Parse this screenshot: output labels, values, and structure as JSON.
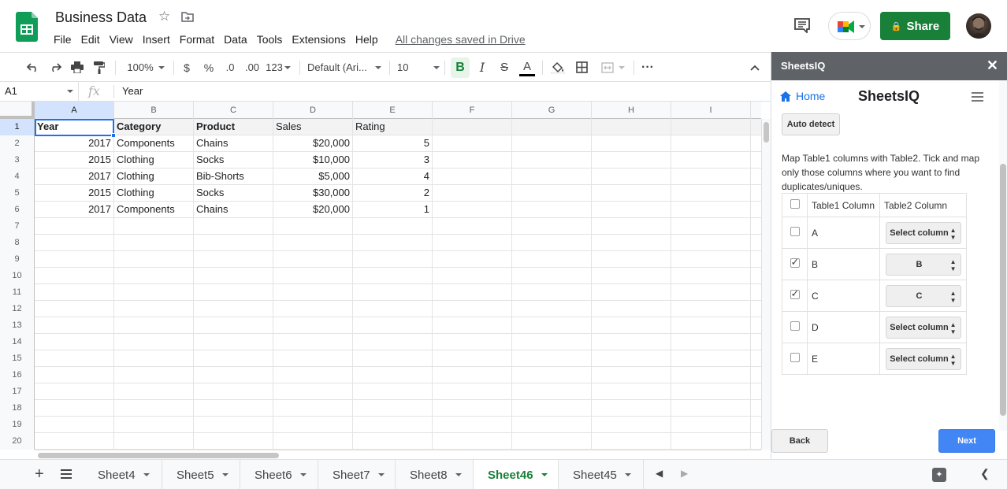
{
  "header": {
    "title": "Business Data",
    "menu": [
      "File",
      "Edit",
      "View",
      "Insert",
      "Format",
      "Data",
      "Tools",
      "Extensions",
      "Help"
    ],
    "saved_status": "All changes saved in Drive",
    "share_label": "Share"
  },
  "toolbar": {
    "zoom": "100%",
    "currency": "$",
    "percent": "%",
    "decrease_decimal": ".0",
    "increase_decimal": ".00",
    "more_formats": "123",
    "font": "Default (Ari...",
    "font_size": "10",
    "bold": "B",
    "text_color": "A",
    "more": "···"
  },
  "formula_bar": {
    "cell_ref": "A1",
    "fx": "fx",
    "value": "Year"
  },
  "grid": {
    "columns": [
      "A",
      "B",
      "C",
      "D",
      "E",
      "F",
      "G",
      "H",
      "I"
    ],
    "row_numbers": [
      "1",
      "2",
      "3",
      "4",
      "5",
      "6",
      "7",
      "8",
      "9",
      "10",
      "11",
      "12",
      "13",
      "14",
      "15",
      "16",
      "17",
      "18",
      "19",
      "20"
    ],
    "header_row": [
      "Year",
      "Category",
      "Product",
      "Sales",
      "Rating"
    ],
    "rows": [
      [
        "2017",
        "Components",
        "Chains",
        "$20,000",
        "5"
      ],
      [
        "2015",
        "Clothing",
        "Socks",
        "$10,000",
        "3"
      ],
      [
        "2017",
        "Clothing",
        "Bib-Shorts",
        "$5,000",
        "4"
      ],
      [
        "2015",
        "Clothing",
        "Socks",
        "$30,000",
        "2"
      ],
      [
        "2017",
        "Components",
        "Chains",
        "$20,000",
        "1"
      ]
    ]
  },
  "sheets": {
    "tabs": [
      "Sheet4",
      "Sheet5",
      "Sheet6",
      "Sheet7",
      "Sheet8",
      "Sheet46",
      "Sheet45"
    ],
    "active": "Sheet46"
  },
  "panel": {
    "title": "SheetsIQ",
    "close": "✕",
    "home": "Home",
    "brand": "SheetsIQ",
    "auto_detect": "Auto detect",
    "instructions": "Map Table1 columns with Table2. Tick and map only those columns where you want to find duplicates/uniques.",
    "table_headers": [
      "Table1 Column",
      "Table2 Column"
    ],
    "mappings": [
      {
        "column": "A",
        "checked": false,
        "select": "Select column"
      },
      {
        "column": "B",
        "checked": true,
        "select": "B"
      },
      {
        "column": "C",
        "checked": true,
        "select": "C"
      },
      {
        "column": "D",
        "checked": false,
        "select": "Select column"
      },
      {
        "column": "E",
        "checked": false,
        "select": "Select column"
      }
    ],
    "back": "Back",
    "next": "Next"
  },
  "colors": {
    "sheets_green": "#188038",
    "selection_blue": "#1a73e8",
    "panel_header": "#5f6368",
    "next_button": "#4285f4"
  },
  "icons": [
    "sheets-logo-icon",
    "star-icon",
    "move-folder-icon",
    "comment-icon",
    "meet-icon",
    "lock-icon",
    "undo-icon",
    "redo-icon",
    "print-icon",
    "paint-format-icon",
    "fill-color-icon",
    "borders-icon",
    "merge-cells-icon",
    "collapse-toolbar-icon",
    "home-icon",
    "hamburger-menu-icon",
    "explore-icon"
  ]
}
